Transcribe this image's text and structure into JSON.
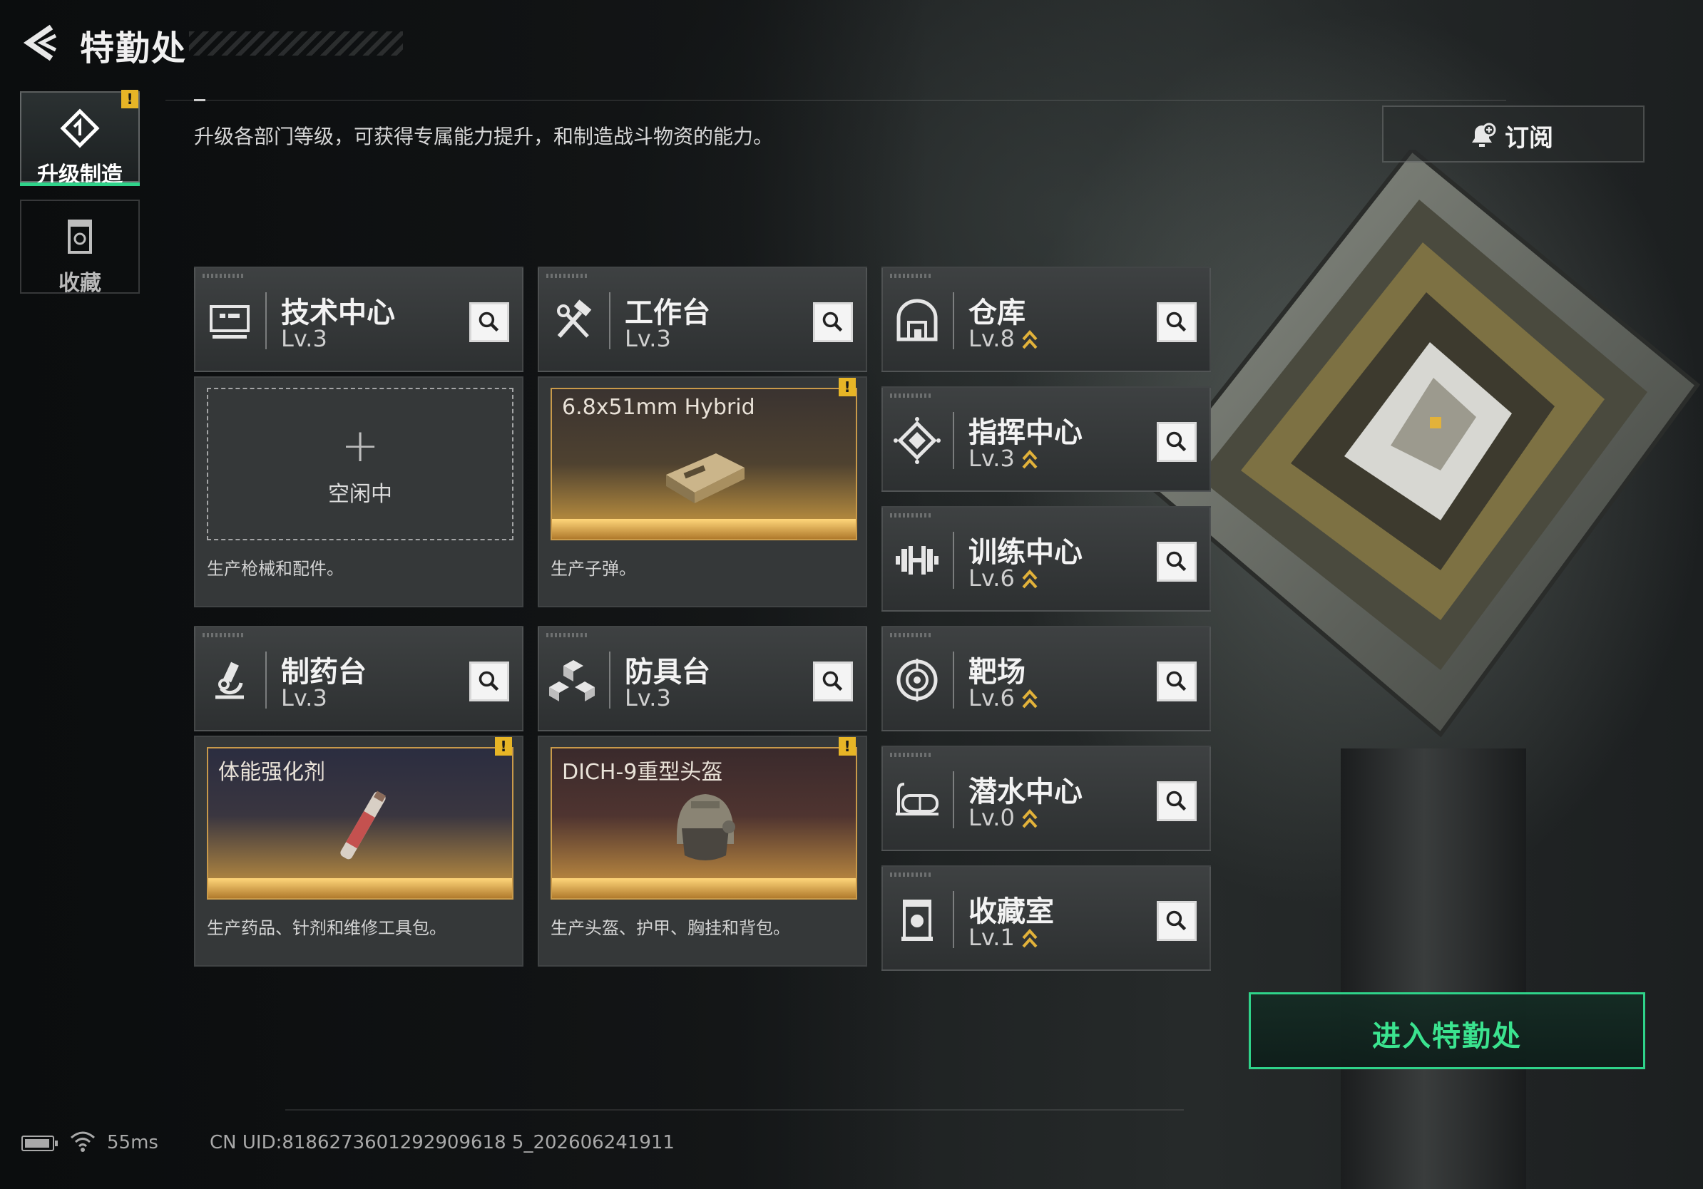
{
  "header": {
    "title": "特勤处",
    "description": "升级各部门等级，可获得专属能力提升，和制造战斗物资的能力。"
  },
  "side_tabs": [
    {
      "label": "升级制造",
      "icon": "upgrade-cube-icon",
      "active": true,
      "alert": "!"
    },
    {
      "label": "收藏",
      "icon": "collection-jar-icon",
      "active": false
    }
  ],
  "subscribe": {
    "label": "订阅",
    "icon": "bell-add-icon"
  },
  "stations": {
    "tech": {
      "name": "技术中心",
      "level": "Lv.3",
      "slot_idle": "空闲中",
      "desc": "生产枪械和配件。"
    },
    "workbench": {
      "name": "工作台",
      "level": "Lv.3",
      "item": "6.8x51mm Hybrid",
      "alert": "!",
      "desc": "生产子弹。"
    },
    "pharmacy": {
      "name": "制药台",
      "level": "Lv.3",
      "item": "体能强化剂",
      "alert": "!",
      "desc": "生产药品、针剂和维修工具包。"
    },
    "armor": {
      "name": "防具台",
      "level": "Lv.3",
      "item": "DICH-9重型头盔",
      "alert": "!",
      "desc": "生产头盔、护甲、胸挂和背包。"
    },
    "warehouse": {
      "name": "仓库",
      "level": "Lv.8"
    },
    "command": {
      "name": "指挥中心",
      "level": "Lv.3"
    },
    "training": {
      "name": "训练中心",
      "level": "Lv.6"
    },
    "range": {
      "name": "靶场",
      "level": "Lv.6"
    },
    "diving": {
      "name": "潜水中心",
      "level": "Lv.0"
    },
    "collection": {
      "name": "收藏室",
      "level": "Lv.1"
    }
  },
  "enter_button": {
    "label": "进入特勤处",
    "color": "#3be38f"
  },
  "status_bar": {
    "ping": "55ms",
    "uid": "CN UID:8186273601292909618 5_202606241911"
  },
  "colors": {
    "accent_green": "#2fd38a",
    "alert_yellow": "#e7b526",
    "upgrade_gold": "#e2b23a"
  }
}
